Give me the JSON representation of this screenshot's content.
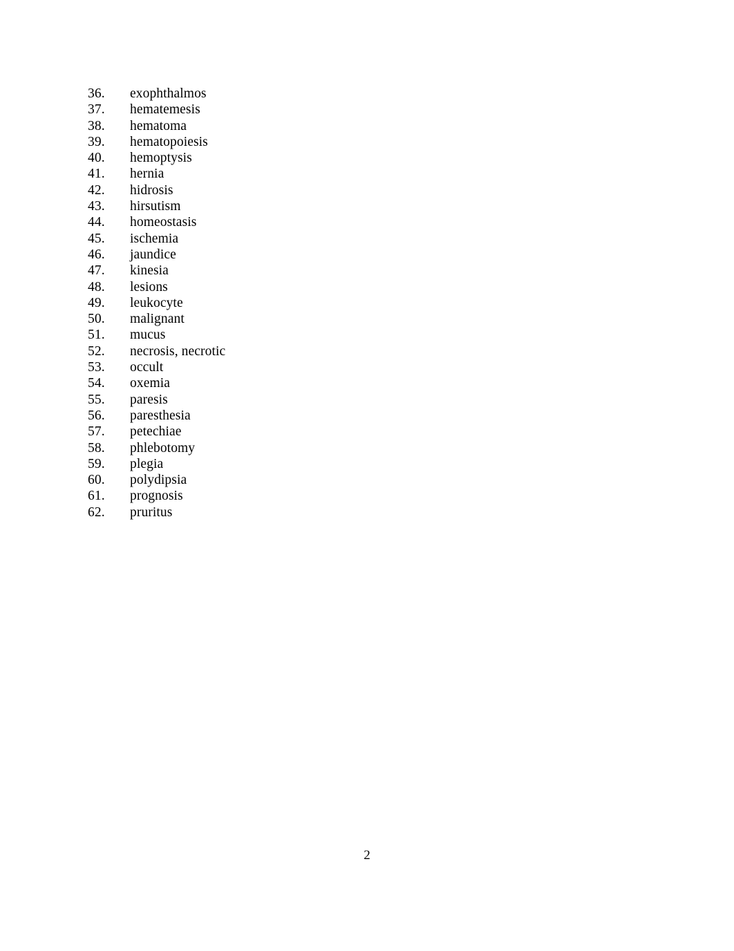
{
  "document": {
    "page_number": "2",
    "list": [
      {
        "number": "36.",
        "term": "exophthalmos"
      },
      {
        "number": "37.",
        "term": "hematemesis"
      },
      {
        "number": "38.",
        "term": "hematoma"
      },
      {
        "number": "39.",
        "term": "hematopoiesis"
      },
      {
        "number": "40.",
        "term": "hemoptysis"
      },
      {
        "number": "41.",
        "term": "hernia"
      },
      {
        "number": "42.",
        "term": "hidrosis"
      },
      {
        "number": "43.",
        "term": "hirsutism"
      },
      {
        "number": "44.",
        "term": "homeostasis"
      },
      {
        "number": "45.",
        "term": "ischemia"
      },
      {
        "number": "46.",
        "term": "jaundice"
      },
      {
        "number": "47.",
        "term": "kinesia"
      },
      {
        "number": "48.",
        "term": "lesions"
      },
      {
        "number": "49.",
        "term": "leukocyte"
      },
      {
        "number": "50.",
        "term": "malignant"
      },
      {
        "number": "51.",
        "term": "mucus"
      },
      {
        "number": "52.",
        "term": "necrosis, necrotic"
      },
      {
        "number": "53.",
        "term": "occult"
      },
      {
        "number": "54.",
        "term": "oxemia"
      },
      {
        "number": "55.",
        "term": "paresis"
      },
      {
        "number": "56.",
        "term": "paresthesia"
      },
      {
        "number": "57.",
        "term": "petechiae"
      },
      {
        "number": "58.",
        "term": "phlebotomy"
      },
      {
        "number": "59.",
        "term": "plegia"
      },
      {
        "number": "60.",
        "term": "polydipsia"
      },
      {
        "number": "61.",
        "term": "prognosis"
      },
      {
        "number": "62.",
        "term": "pruritus"
      }
    ]
  }
}
